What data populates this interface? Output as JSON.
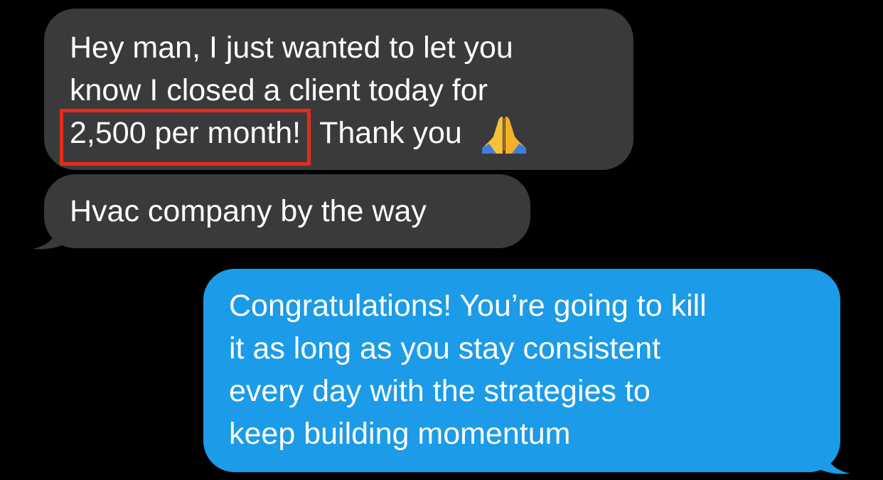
{
  "conversation": {
    "messages": [
      {
        "sender": "incoming",
        "lines": [
          "Hey man, I just wanted to let you",
          "know I closed a client today for"
        ],
        "highlight_text": "2,500 per month!",
        "trailing_text": "Thank you",
        "emoji": "folded-hands-icon"
      },
      {
        "sender": "incoming",
        "lines": [
          "Hvac company by the way"
        ]
      },
      {
        "sender": "outgoing",
        "lines": [
          "Congratulations! You’re going to kill",
          "it as long as you stay consistent",
          "every day with the strategies to",
          "keep building momentum"
        ]
      }
    ]
  },
  "colors": {
    "background": "#000000",
    "incoming_bubble": "#3a3a3c",
    "outgoing_bubble": "#1b9be8",
    "text": "#ffffff",
    "highlight_border": "#e62b19"
  }
}
